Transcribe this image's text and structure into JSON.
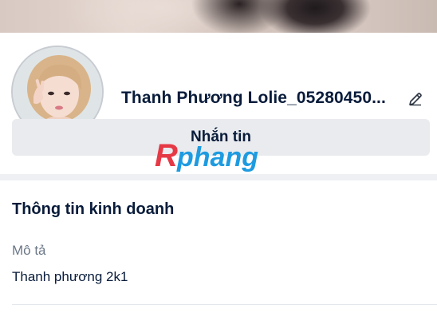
{
  "profile": {
    "name": "Thanh Phương Lolie_05280450..."
  },
  "actions": {
    "message_label": "Nhắn tin"
  },
  "watermark": {
    "text": "Rphang",
    "colors": [
      "#e63946",
      "#1e9be0"
    ]
  },
  "business_info": {
    "title": "Thông tin kinh doanh",
    "description_label": "Mô tả",
    "description_value": "Thanh phương 2k1"
  },
  "icons": {
    "edit": "pencil-icon"
  }
}
